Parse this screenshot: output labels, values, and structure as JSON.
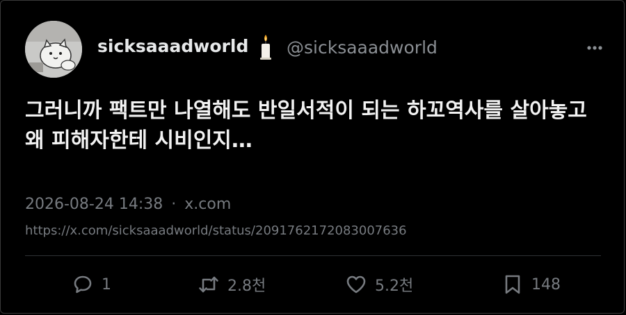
{
  "author": {
    "display_name": "sicksaaadworld",
    "handle": "@sicksaaadworld",
    "avatar_icon": "cat-avatar",
    "badge_icon": "candle-emoji"
  },
  "post": {
    "text": "그러니까 팩트만 나열해도 반일서적이 되는 하꼬역사를 살아놓고 왜 피해자한테 시비인지…",
    "timestamp": "2026-08-24 14:38",
    "separator": "·",
    "source": "x.com",
    "url": "https://x.com/sicksaaadworld/status/2091762172083007636"
  },
  "actions": {
    "replies": "1",
    "reposts": "2.8천",
    "likes": "5.2천",
    "bookmarks": "148"
  },
  "colors": {
    "background": "#000000",
    "primary_text": "#e7e9ea",
    "secondary_text": "#777b80",
    "divider": "#2f3336"
  }
}
